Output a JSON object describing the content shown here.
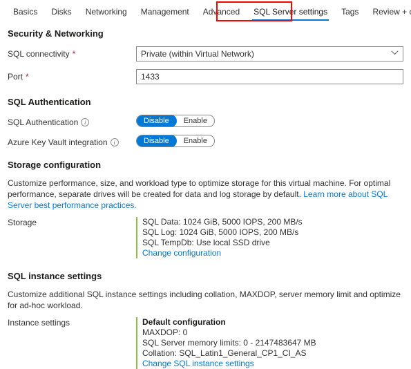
{
  "tabs": [
    {
      "label": "Basics",
      "active": false
    },
    {
      "label": "Disks",
      "active": false
    },
    {
      "label": "Networking",
      "active": false
    },
    {
      "label": "Management",
      "active": false
    },
    {
      "label": "Advanced",
      "active": false
    },
    {
      "label": "SQL Server settings",
      "active": true
    },
    {
      "label": "Tags",
      "active": false
    },
    {
      "label": "Review + create",
      "active": false
    }
  ],
  "annotation": {
    "color": "#ff0000",
    "target": "SQL Server settings"
  },
  "security": {
    "title": "Security & Networking",
    "connectivity_label": "SQL connectivity",
    "connectivity_required": "*",
    "connectivity_value": "Private (within Virtual Network)",
    "chevron": "⌄",
    "port_label": "Port",
    "port_required": "*",
    "port_value": "1433"
  },
  "auth": {
    "title": "SQL Authentication",
    "sql_auth_label": "SQL Authentication",
    "sql_auth_info": "i",
    "sql_auth_disable": "Disable",
    "sql_auth_enable": "Enable",
    "keyvault_label": "Azure Key Vault integration",
    "keyvault_info": "i",
    "keyvault_disable": "Disable",
    "keyvault_enable": "Enable"
  },
  "storage": {
    "title": "Storage configuration",
    "description": "Customize performance, size, and workload type to optimize storage for this virtual machine. For optimal performance, separate drives will be created for data and log storage by default. ",
    "learn_more": "Learn more about SQL Server best performance practices.",
    "row_label": "Storage",
    "lines": [
      "SQL Data: 1024 GiB, 5000 IOPS, 200 MB/s",
      "SQL Log: 1024 GiB, 5000 IOPS, 200 MB/s",
      "SQL TempDb: Use local SSD drive"
    ],
    "change_link": "Change configuration",
    "accent_color": "#8cbf45"
  },
  "instance": {
    "title": "SQL instance settings",
    "description": "Customize additional SQL instance settings including collation, MAXDOP, server memory limit and optimize for ad-hoc workload.",
    "row_label": "Instance settings",
    "heading": "Default configuration",
    "lines": [
      "MAXDOP: 0",
      "SQL Server memory limits: 0 - 2147483647 MB",
      "Collation: SQL_Latin1_General_CP1_CI_AS"
    ],
    "change_link": "Change SQL instance settings",
    "accent_color": "#8cbf45"
  },
  "colors": {
    "accent_blue": "#0078d4",
    "required_red": "#a4262c",
    "annotation_red": "#ff0000",
    "accent_green": "#8cbf45"
  }
}
